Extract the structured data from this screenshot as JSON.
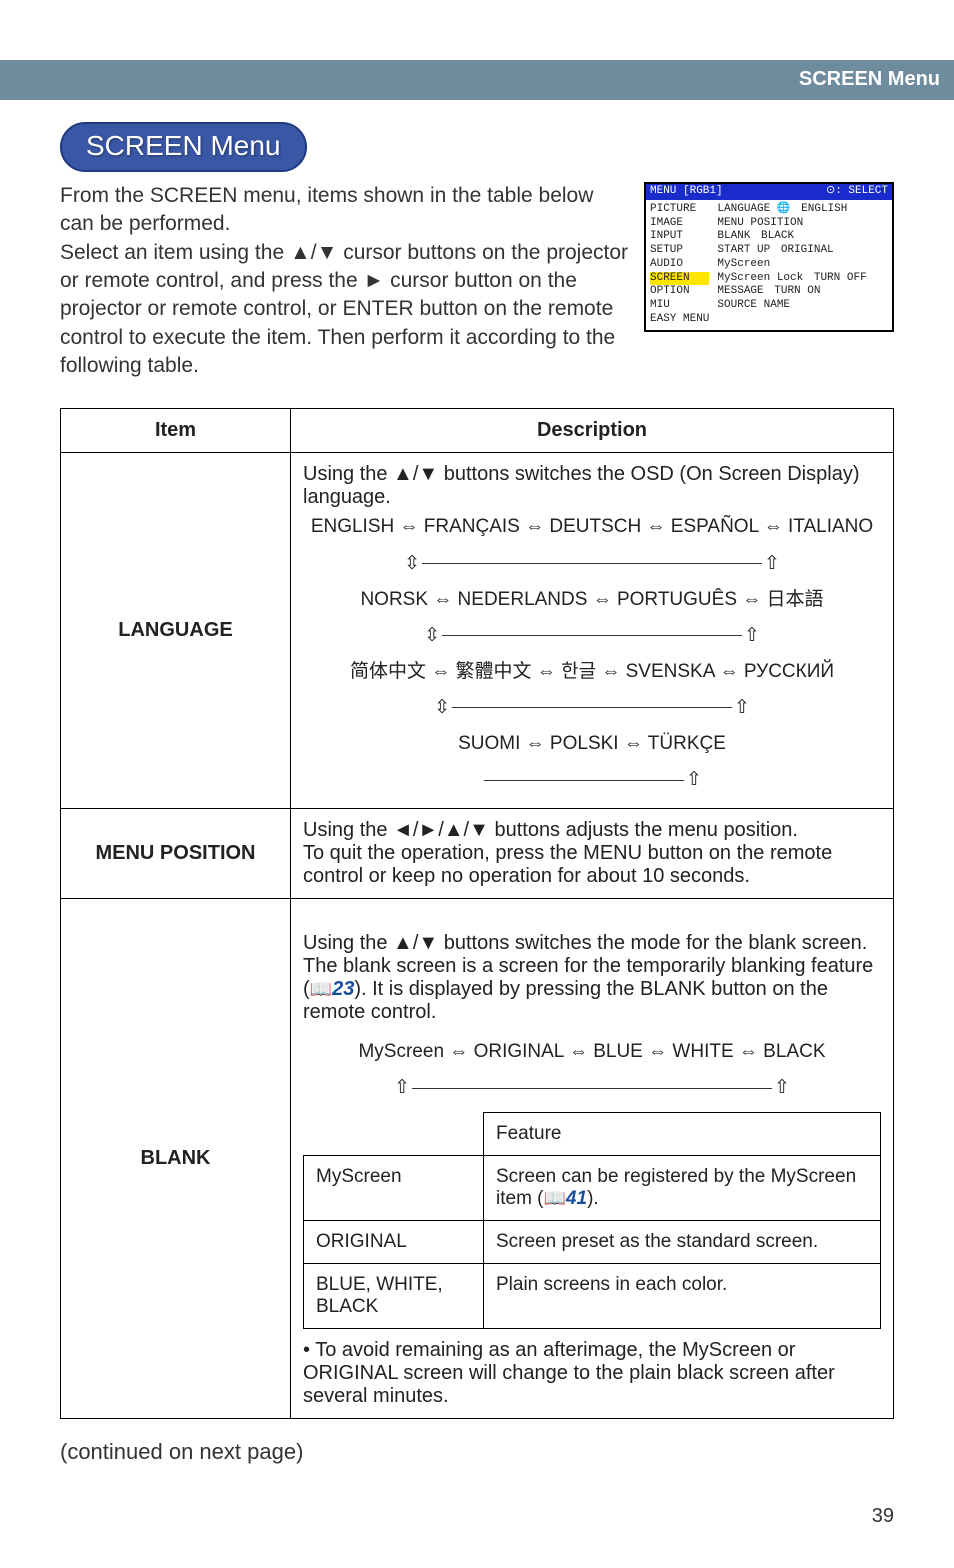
{
  "topbar_title": "SCREEN Menu",
  "badge": "SCREEN Menu",
  "intro": "From the SCREEN menu, items shown in the table below can be performed.\nSelect an item using the ▲/▼ cursor buttons on the projector or remote control, and press the ► cursor button on the projector or remote control, or ENTER button on the remote control to execute the item. Then perform it according to the following table.",
  "osd": {
    "header_left": "MENU [RGB1]",
    "header_right": ": SELECT",
    "left": [
      "PICTURE",
      "IMAGE",
      "INPUT",
      "SETUP",
      "AUDIO",
      "SCREEN",
      "OPTION",
      "MIU",
      "EASY MENU"
    ],
    "right": [
      {
        "label": "LANGUAGE",
        "value": "ENGLISH",
        "globe": true
      },
      {
        "label": "MENU POSITION",
        "value": ""
      },
      {
        "label": "BLANK",
        "value": "BLACK"
      },
      {
        "label": "START UP",
        "value": "ORIGINAL"
      },
      {
        "label": "MyScreen",
        "value": ""
      },
      {
        "label": "MyScreen Lock",
        "value": "TURN OFF"
      },
      {
        "label": "MESSAGE",
        "value": "TURN ON"
      },
      {
        "label": "SOURCE NAME",
        "value": ""
      }
    ]
  },
  "table": {
    "head_item": "Item",
    "head_desc": "Description",
    "rows": {
      "language": {
        "label": "LANGUAGE",
        "lead": "Using the ▲/▼ buttons switches the OSD (On Screen Display) language.",
        "line1": "ENGLISH ⇔ FRANÇAIS ⇔ DEUTSCH ⇔ ESPAÑOL ⇔ ITALIANO",
        "line2": "NORSK ⇔ NEDERLANDS ⇔ PORTUGUÊS ⇔ 日本語",
        "line3": "简体中文 ⇔ 繁體中文 ⇔ 한글 ⇔ SVENSKA ⇔ РУССКИЙ",
        "line4": "SUOMI ⇔ POLSKI ⇔ TÜRKÇE"
      },
      "menu_position": {
        "label": "MENU POSITION",
        "desc": "Using the ◄/►/▲/▼ buttons adjusts the menu position.\nTo quit the operation, press the MENU button on the remote control or keep no operation for about 10 seconds."
      },
      "blank": {
        "label": "BLANK",
        "lead_a": "Using the ▲/▼ buttons switches the mode for the blank screen.\nThe blank screen is a screen for the temporarily blanking feature (",
        "lead_ref": "23",
        "lead_b": "). It is displayed by pressing the BLANK button on the remote control.",
        "cycle": "MyScreen ⇔ ORIGINAL ⇔ BLUE ⇔ WHITE ⇔ BLACK",
        "feature_head": "Feature",
        "rows": [
          {
            "k": "MyScreen",
            "v_a": "Screen can be registered by the MyScreen item (",
            "v_ref": "41",
            "v_b": ")."
          },
          {
            "k": "ORIGINAL",
            "v": "Screen preset as the standard screen."
          },
          {
            "k": "BLUE, WHITE, BLACK",
            "v": "Plain screens in each color."
          }
        ],
        "note": "• To avoid remaining as an afterimage, the MyScreen or ORIGINAL screen will change to the plain black screen after several minutes."
      }
    }
  },
  "continued": "(continued on next page)",
  "page_number": "39"
}
